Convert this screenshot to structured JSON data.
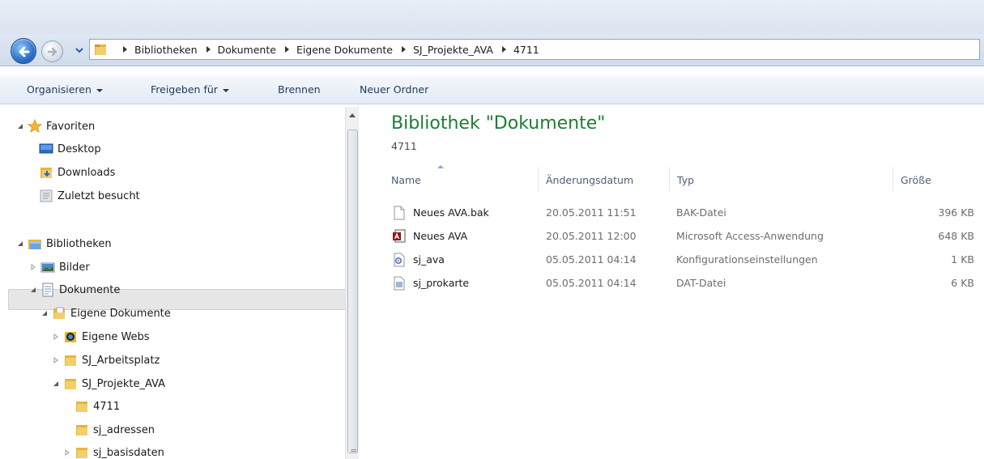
{
  "address_bar": {
    "breadcrumbs": [
      "Bibliotheken",
      "Dokumente",
      "Eigene Dokumente",
      "SJ_Projekte_AVA",
      "4711"
    ]
  },
  "commands": {
    "organize": "Organisieren",
    "share": "Freigeben für",
    "burn": "Brennen",
    "new_folder": "Neuer Ordner"
  },
  "nav": {
    "favorites": {
      "label": "Favoriten",
      "items": [
        "Desktop",
        "Downloads",
        "Zuletzt besucht"
      ]
    },
    "libraries": {
      "label": "Bibliotheken",
      "pictures": "Bilder",
      "documents": "Dokumente",
      "my_documents": "Eigene Dokumente",
      "my_webs": "Eigene Webs",
      "workspace": "SJ_Arbeitsplatz",
      "projects": "SJ_Projekte_AVA",
      "selected_folder": "4711",
      "addresses": "sj_adressen",
      "basedata": "sj_basisdaten"
    }
  },
  "content": {
    "title": "Bibliothek \"Dokumente\"",
    "subtitle": "4711",
    "columns": {
      "name": "Name",
      "modified": "Änderungsdatum",
      "type": "Typ",
      "size": "Größe"
    },
    "files": [
      {
        "name": "Neues AVA.bak",
        "modified": "20.05.2011 11:51",
        "type": "BAK-Datei",
        "size": "396 KB",
        "icon": "blank-file-icon"
      },
      {
        "name": "Neues AVA",
        "modified": "20.05.2011 12:00",
        "type": "Microsoft Access-Anwendung",
        "size": "648 KB",
        "icon": "access-file-icon"
      },
      {
        "name": "sj_ava",
        "modified": "05.05.2011 04:14",
        "type": "Konfigurationseinstellungen",
        "size": "1 KB",
        "icon": "config-file-icon"
      },
      {
        "name": "sj_prokarte",
        "modified": "05.05.2011 04:14",
        "type": "DAT-Datei",
        "size": "6 KB",
        "icon": "dat-file-icon"
      }
    ]
  },
  "colors": {
    "library_title": "#1e7d33",
    "command_text": "#1e395b",
    "selection": "#e6e6e6"
  }
}
